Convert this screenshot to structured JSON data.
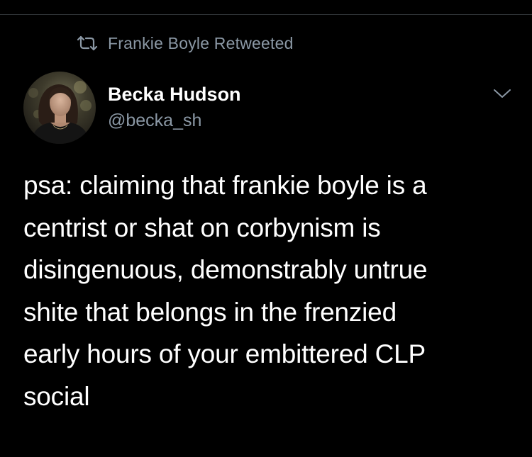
{
  "retweet_banner": {
    "text": "Frankie Boyle Retweeted",
    "icon": "retweet-icon"
  },
  "tweet": {
    "author_name": "Becka Hudson",
    "author_handle": "@becka_sh",
    "avatar": "avatar-photo",
    "menu_icon": "chevron-down-icon",
    "body": "psa: claiming that frankie boyle is a\ncentrist or shat on corbynism is\ndisingenuous, demonstrably untrue\nshite that belongs in the frenzied\nearly hours of your embittered CLP\nsocial"
  },
  "colors": {
    "background": "#000000",
    "primary_text": "#ffffff",
    "secondary_text": "#8b98a5",
    "divider": "#2f3336"
  }
}
